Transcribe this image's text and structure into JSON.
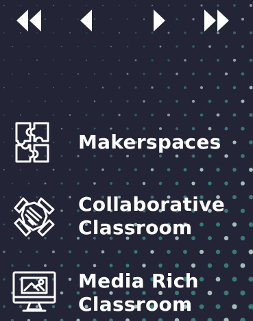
{
  "nav": {
    "first_icon": "double-chevron-left",
    "prev_icon": "chevron-left",
    "next_icon": "chevron-right",
    "last_icon": "double-chevron-right"
  },
  "items": [
    {
      "icon": "puzzle-icon",
      "lines": [
        "Makerspaces"
      ]
    },
    {
      "icon": "hands-together-icon",
      "lines": [
        "Collaborative",
        "Classroom"
      ]
    },
    {
      "icon": "monitor-image-icon",
      "lines": [
        "Media Rich",
        "Classroom"
      ]
    }
  ],
  "colors": {
    "background": "#232536",
    "dot_teal": "#3a8a86",
    "dot_light": "#b8d8d2",
    "foreground": "#ffffff"
  }
}
